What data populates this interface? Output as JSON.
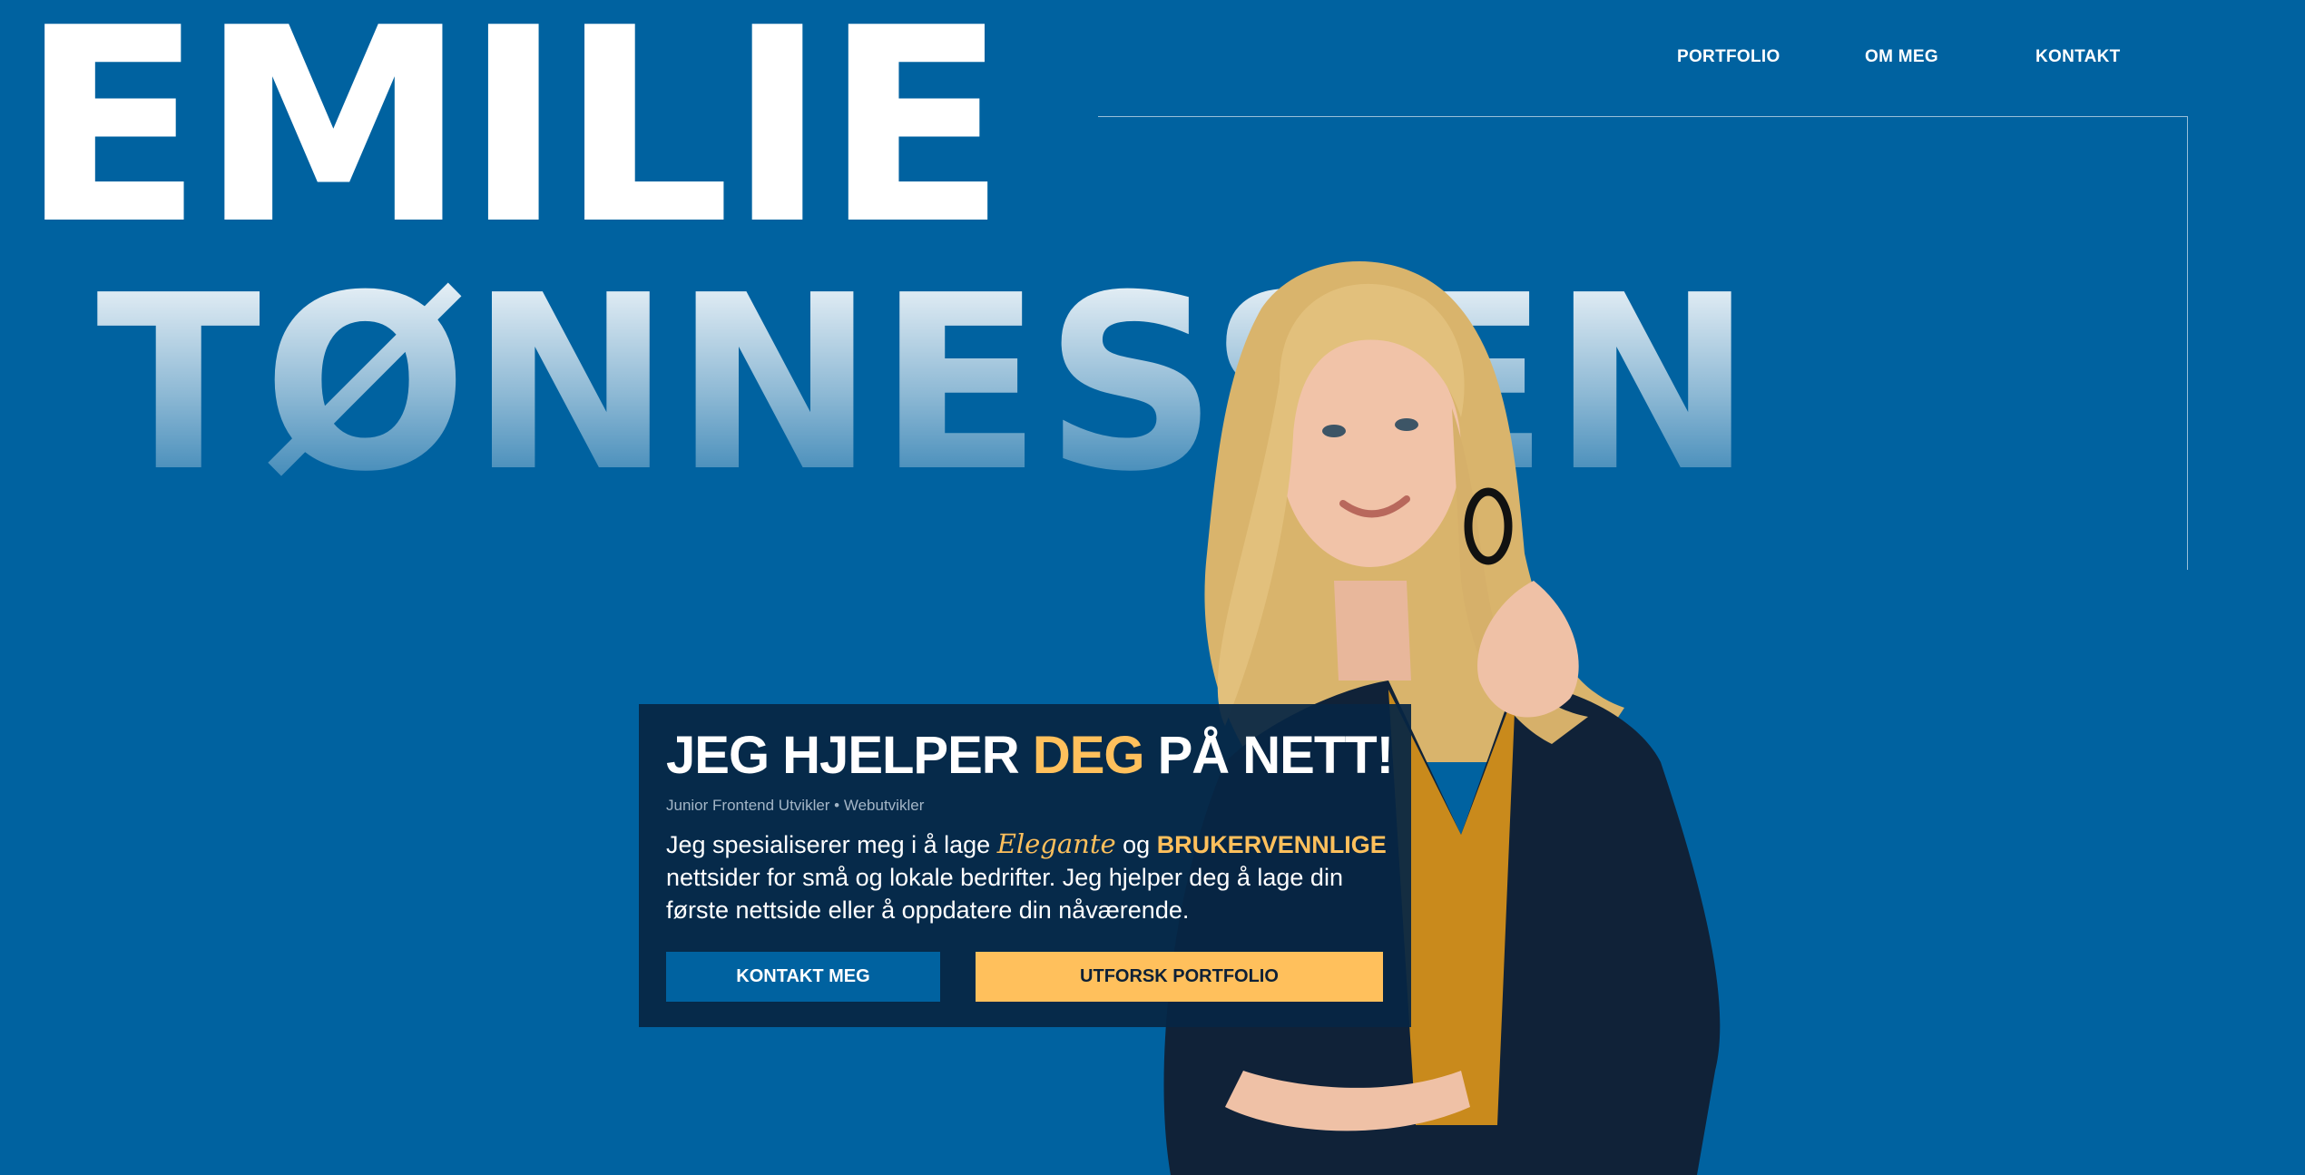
{
  "hero": {
    "first_name": "EMILIE",
    "last_name": "TØNNESSEN"
  },
  "nav": {
    "items": [
      {
        "label": "PORTFOLIO"
      },
      {
        "label": "OM MEG"
      },
      {
        "label": "KONTAKT"
      }
    ]
  },
  "card": {
    "headline_part1": "JEG HJELPER ",
    "headline_highlight": "DEG",
    "headline_part2": " PÅ NETT!",
    "subtitle": "Junior Frontend Utvikler • Webutvikler",
    "desc_part1": "Jeg spesialiserer meg i å lage ",
    "desc_elegant": "Elegante",
    "desc_part2": " og ",
    "desc_friendly": "BRUKERVENNLIGE",
    "desc_part3": " nettsider for små og lokale bedrifter. Jeg hjelper deg å lage din første nettside eller å oppdatere din nåværende.",
    "button_contact": "KONTAKT MEG",
    "button_portfolio": "UTFORSK PORTFOLIO"
  },
  "colors": {
    "background": "#0062a0",
    "accent": "#ffc05c",
    "card": "#062644",
    "text": "#ffffff"
  },
  "icons": [
    "portrait-photo"
  ]
}
